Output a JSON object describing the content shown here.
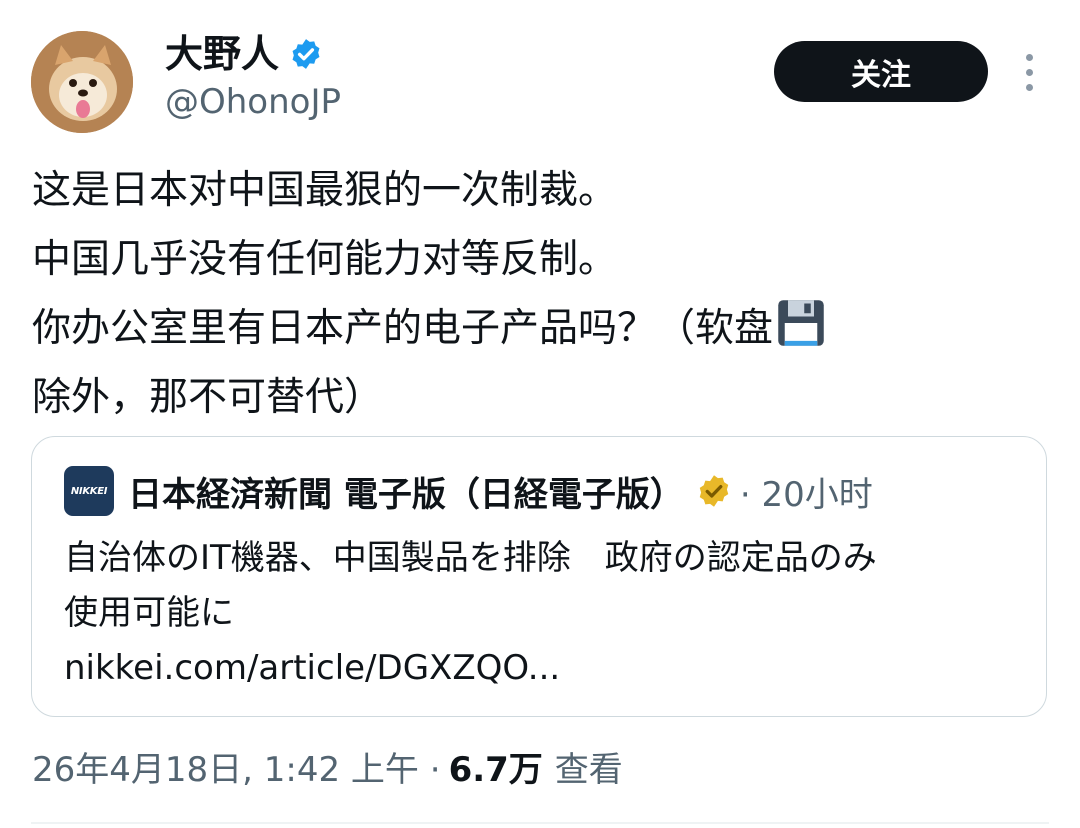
{
  "author": {
    "display_name": "大野人",
    "handle": "@OhonoJP",
    "verified": true,
    "verified_color": "#1d9bf0"
  },
  "follow_button": {
    "label": "关注"
  },
  "more_button": {
    "icon": "more-vertical-icon"
  },
  "tweet": {
    "lines": [
      "这是日本对中国最狠的一次制裁。",
      "中国几乎没有任何能力对等反制。",
      "你办公室里有日本产的电子产品吗？（软盘",
      "除外，那不可替代）"
    ],
    "emoji": "floppy-disk-icon"
  },
  "quoted_card": {
    "logo_text": "NIKKEI",
    "source_name": "日本経済新聞 電子版（日経電子版）",
    "badge": "gold-verified-icon",
    "badge_color": "#e8b829",
    "time": "· 20小时",
    "body_lines": [
      "自治体のIT機器、中国製品を排除　政府の認定品のみ",
      "使用可能に",
      "nikkei.com/article/DGXZQO..."
    ]
  },
  "meta": {
    "timestamp": "26年4月18日, 1:42 上午 ·",
    "views_count": "6.7万",
    "views_label": "查看"
  },
  "colors": {
    "text_primary": "#0f1419",
    "text_secondary": "#536471",
    "border": "#cfd9de",
    "button_bg": "#0f1419"
  }
}
